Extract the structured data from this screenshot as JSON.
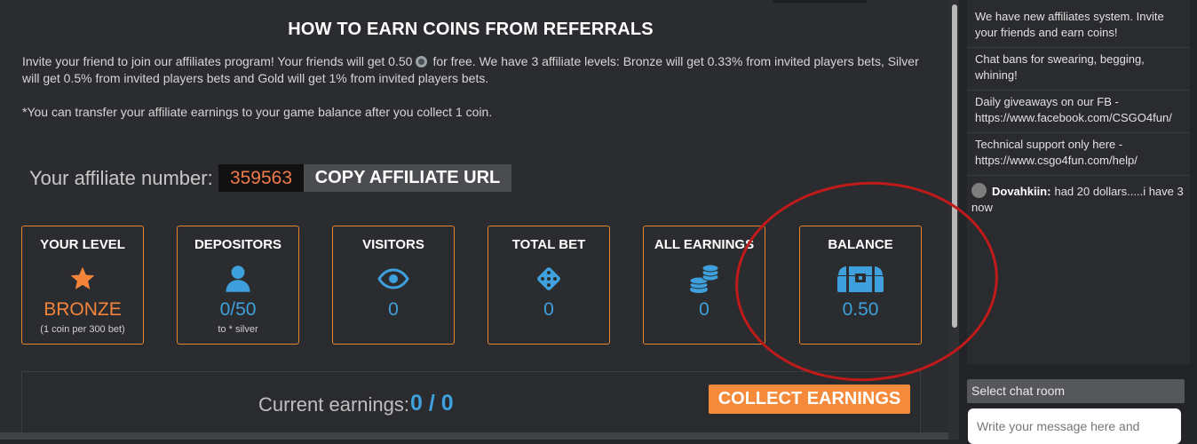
{
  "affiliates": {
    "title": "HOW TO EARN COINS FROM REFERRALS",
    "intro_part1": "Invite your friend to join our affiliates program! Your friends will get 0.50",
    "intro_part2": "for free. We have 3 affiliate levels: Bronze will get 0.33% from invited players bets, Silver will get 0.5% from invited players bets and Gold will get 1% from invited players bets.",
    "note": "*You can transfer your affiliate earnings to your game balance after you collect 1 coin.",
    "affiliate_label": "Your affiliate number:",
    "affiliate_number": "359563",
    "copy_button": "COPY AFFILIATE URL",
    "stats": [
      {
        "label": "YOUR LEVEL",
        "icon": "star-icon",
        "value": "BRONZE",
        "sub": "(1 coin per 300 bet)"
      },
      {
        "label": "DEPOSITORS",
        "icon": "user-icon",
        "value": "0/50",
        "sub": "to * silver"
      },
      {
        "label": "VISITORS",
        "icon": "eye-icon",
        "value": "0",
        "sub": ""
      },
      {
        "label": "TOTAL BET",
        "icon": "dice-icon",
        "value": "0",
        "sub": ""
      },
      {
        "label": "ALL EARNINGS",
        "icon": "coins-icon",
        "value": "0",
        "sub": ""
      },
      {
        "label": "BALANCE",
        "icon": "chest-icon",
        "value": "0.50",
        "sub": ""
      }
    ],
    "earnings_label": "Current earnings:",
    "earnings_value": "0 / 0",
    "collect_button": "COLLECT EARNINGS"
  },
  "chat": {
    "messages": [
      {
        "text": "We have new affiliates system. Invite your friends and earn coins!"
      },
      {
        "text": "Chat bans for swearing, begging, whining!"
      },
      {
        "text": "Daily giveaways on our FB - https://www.facebook.com/CSGO4fun/"
      },
      {
        "text": "Technical support only here - https://www.csgo4fun.com/help/"
      },
      {
        "user": "Dovahkiin:",
        "text": "had 20 dollars.....i have 3 now"
      }
    ],
    "select_room": "Select chat room",
    "input_placeholder": "Write your message here and"
  },
  "colors": {
    "accent_orange": "#f48a3a",
    "value_blue": "#3ea0dc",
    "annotation_red": "#c01a1a"
  }
}
